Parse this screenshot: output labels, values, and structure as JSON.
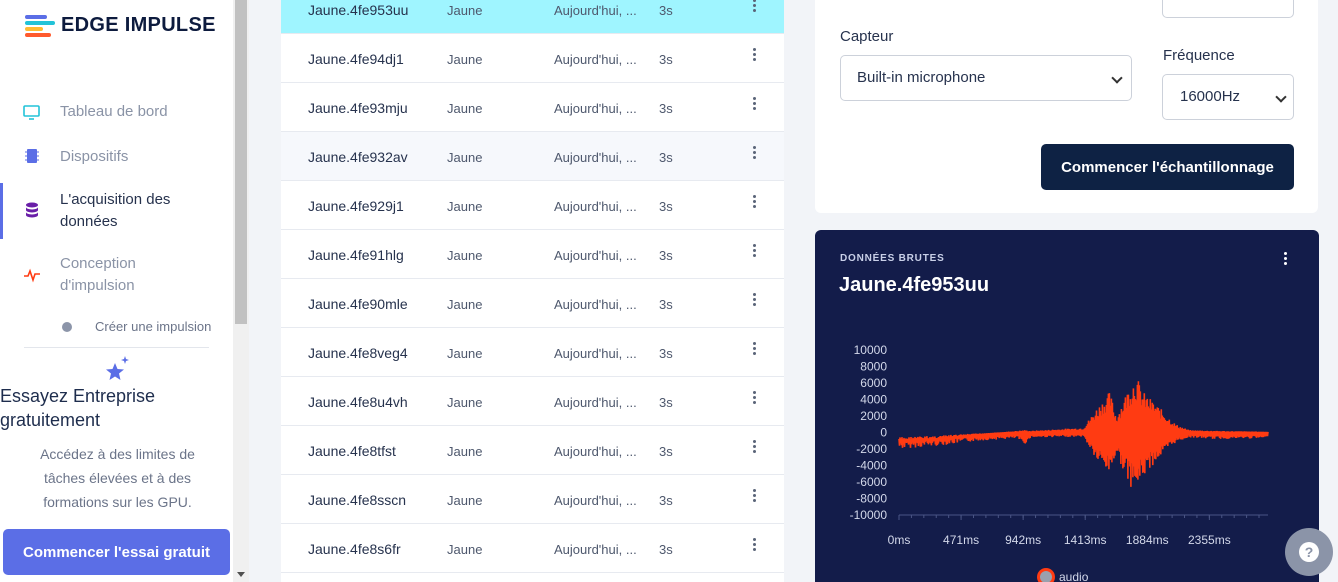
{
  "app": {
    "logo_text": "EDGE IMPULSE"
  },
  "sidebar": {
    "items": [
      {
        "label": "Tableau de bord",
        "icon": "monitor-icon"
      },
      {
        "label": "Dispositifs",
        "icon": "chip-icon"
      },
      {
        "label": "L'acquisition des données",
        "icon": "database-icon"
      },
      {
        "label": "Conception d'impulsion",
        "icon": "pulse-icon"
      }
    ],
    "subitem": "Créer une impulsion",
    "promo": {
      "title": "Essayez Entreprise gratuitement",
      "description": "Accédez à des limites de tâches élevées et à des formations sur les GPU.",
      "button": "Commencer l'essai gratuit"
    }
  },
  "samples": [
    {
      "name": "Jaune.4fe953uu",
      "label": "Jaune",
      "date": "Aujourd'hui, ...",
      "length": "3s"
    },
    {
      "name": "Jaune.4fe94dj1",
      "label": "Jaune",
      "date": "Aujourd'hui, ...",
      "length": "3s"
    },
    {
      "name": "Jaune.4fe93mju",
      "label": "Jaune",
      "date": "Aujourd'hui, ...",
      "length": "3s"
    },
    {
      "name": "Jaune.4fe932av",
      "label": "Jaune",
      "date": "Aujourd'hui, ...",
      "length": "3s"
    },
    {
      "name": "Jaune.4fe929j1",
      "label": "Jaune",
      "date": "Aujourd'hui, ...",
      "length": "3s"
    },
    {
      "name": "Jaune.4fe91hlg",
      "label": "Jaune",
      "date": "Aujourd'hui, ...",
      "length": "3s"
    },
    {
      "name": "Jaune.4fe90mle",
      "label": "Jaune",
      "date": "Aujourd'hui, ...",
      "length": "3s"
    },
    {
      "name": "Jaune.4fe8veg4",
      "label": "Jaune",
      "date": "Aujourd'hui, ...",
      "length": "3s"
    },
    {
      "name": "Jaune.4fe8u4vh",
      "label": "Jaune",
      "date": "Aujourd'hui, ...",
      "length": "3s"
    },
    {
      "name": "Jaune.4fe8tfst",
      "label": "Jaune",
      "date": "Aujourd'hui, ...",
      "length": "3s"
    },
    {
      "name": "Jaune.4fe8sscn",
      "label": "Jaune",
      "date": "Aujourd'hui, ...",
      "length": "3s"
    },
    {
      "name": "Jaune.4fe8s6fr",
      "label": "Jaune",
      "date": "Aujourd'hui, ...",
      "length": "3s"
    }
  ],
  "collect": {
    "sensor_label": "Capteur",
    "sensor_value": "Built-in microphone",
    "frequency_label": "Fréquence",
    "frequency_value": "16000Hz",
    "start_button": "Commencer l'échantillonnage"
  },
  "raw_data": {
    "eyebrow": "DONNÉES BRUTES",
    "sample_name": "Jaune.4fe953uu"
  },
  "colors": {
    "accent": "#5b6ee6",
    "selected_row": "#9ff5ff",
    "signal": "#ff3b12",
    "raw_bg": "#131c4a",
    "dark_button": "#0e2244"
  },
  "chart_data": {
    "type": "line",
    "ylim": [
      -10000,
      10000
    ],
    "yticks": [
      "10000",
      "8000",
      "6000",
      "4000",
      "2000",
      "0",
      "-2000",
      "-4000",
      "-6000",
      "-8000",
      "-10000"
    ],
    "xticks": [
      "0ms",
      "471ms",
      "942ms",
      "1413ms",
      "1884ms",
      "2355ms"
    ],
    "x_range_ms": [
      0,
      2800
    ],
    "series": [
      {
        "name": "audio",
        "envelope": [
          {
            "x": 0,
            "min": -2000,
            "max": -1000
          },
          {
            "x": 300,
            "min": -1600,
            "max": -700
          },
          {
            "x": 600,
            "min": -1000,
            "max": -200
          },
          {
            "x": 900,
            "min": -700,
            "max": 200
          },
          {
            "x": 950,
            "min": -1500,
            "max": 300
          },
          {
            "x": 1000,
            "min": -600,
            "max": 200
          },
          {
            "x": 1400,
            "min": -500,
            "max": 600
          },
          {
            "x": 1500,
            "min": -3500,
            "max": 3000
          },
          {
            "x": 1600,
            "min": -5000,
            "max": 5000
          },
          {
            "x": 1650,
            "min": -2500,
            "max": 2000
          },
          {
            "x": 1750,
            "min": -6500,
            "max": 5800
          },
          {
            "x": 1800,
            "min": -7000,
            "max": 7000
          },
          {
            "x": 1850,
            "min": -5500,
            "max": 5000
          },
          {
            "x": 1950,
            "min": -3500,
            "max": 3500
          },
          {
            "x": 2100,
            "min": -1200,
            "max": 1000
          },
          {
            "x": 2200,
            "min": -600,
            "max": 300
          },
          {
            "x": 2400,
            "min": -800,
            "max": 200
          },
          {
            "x": 2800,
            "min": -700,
            "max": 100
          }
        ]
      }
    ]
  }
}
